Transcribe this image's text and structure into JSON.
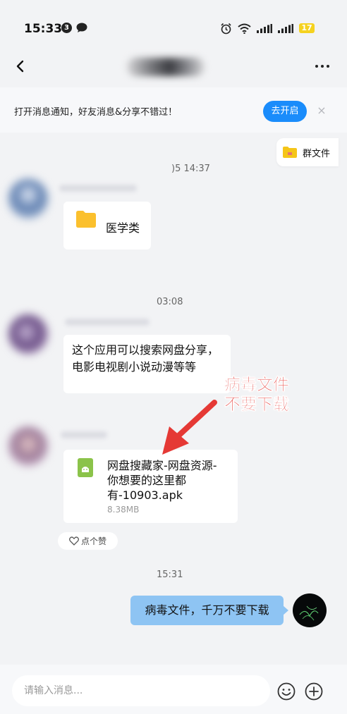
{
  "status_bar": {
    "time": "15:33",
    "notification_count": "3",
    "battery": "17"
  },
  "banner": {
    "text": "打开消息通知，好友消息&分享不错过！",
    "button_label": "去开启",
    "close_glyph": "×"
  },
  "group_files": {
    "label": "群文件"
  },
  "messages": {
    "timestamp_1": ")5 14:37",
    "folder_label": "医学类",
    "timestamp_2": "03:08",
    "text_message": "这个应用可以搜索网盘分享，电影电视剧小说动漫等等",
    "timestamp_3": "",
    "file_name": "网盘搜藏家-网盘资源-你想要的这里都有-10903.apk",
    "file_size": "8.38MB",
    "like_label": "点个赞",
    "timestamp_4": "15:31",
    "outgoing_text": "病毒文件，千万不要下载"
  },
  "annotation": {
    "line1": "病毒文件",
    "line2": "不要下载",
    "color": "#e53935"
  },
  "input": {
    "placeholder": "请输入消息..."
  },
  "icons": [
    "back-arrow-icon",
    "more-dots-icon",
    "folder-icon",
    "apk-file-icon",
    "heart-icon",
    "emoji-icon",
    "plus-circle-icon",
    "alarm-icon",
    "wifi-icon",
    "signal-icon"
  ]
}
